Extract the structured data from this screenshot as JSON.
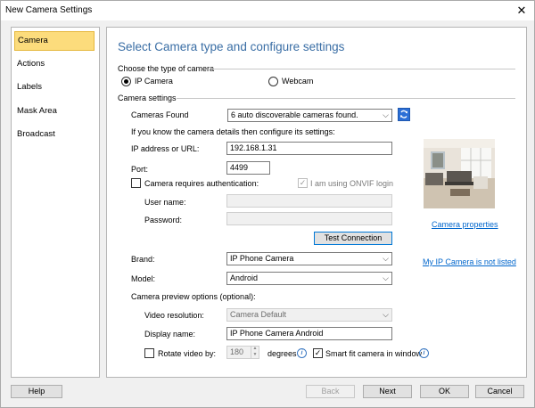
{
  "window": {
    "title": "New Camera Settings",
    "close_glyph": "✕"
  },
  "sidebar": {
    "items": [
      {
        "label": "Camera",
        "active": true
      },
      {
        "label": "Actions"
      },
      {
        "label": "Labels"
      },
      {
        "label": "Mask Area"
      },
      {
        "label": "Broadcast"
      }
    ]
  },
  "main": {
    "heading": "Select Camera type and configure settings",
    "camera_type": {
      "label": "Choose the type of camera",
      "options": [
        "IP Camera",
        "Webcam"
      ],
      "selected": "IP Camera"
    },
    "settings_label": "Camera settings",
    "cameras_found": {
      "label": "Cameras Found",
      "value": "6 auto discoverable cameras found."
    },
    "hint": "If you know the camera details then configure its settings:",
    "ip": {
      "label": "IP address or URL:",
      "value": "192.168.1.31"
    },
    "port": {
      "label": "Port:",
      "value": "4499"
    },
    "auth": {
      "label": "Camera requires authentication:",
      "checked": false,
      "onvif_label": "I am using ONVIF login",
      "onvif_checked": true
    },
    "username": {
      "label": "User name:",
      "value": ""
    },
    "password": {
      "label": "Password:",
      "value": ""
    },
    "test_button": "Test Connection",
    "brand": {
      "label": "Brand:",
      "value": "IP Phone Camera"
    },
    "model": {
      "label": "Model:",
      "value": "Android"
    },
    "preview_label": "Camera preview options (optional):",
    "video_resolution": {
      "label": "Video resolution:",
      "value": "Camera Default"
    },
    "display_name": {
      "label": "Display name:",
      "value": "IP Phone Camera Android"
    },
    "rotate": {
      "label": "Rotate video by:",
      "checked": false,
      "value": "180",
      "unit": "degrees"
    },
    "smart_fit": {
      "label": "Smart fit camera in window",
      "checked": true
    },
    "camera_properties_link": "Camera properties",
    "not_listed_link": "My IP Camera is not listed"
  },
  "footer": {
    "help": "Help",
    "back": "Back",
    "next": "Next",
    "ok": "OK",
    "cancel": "Cancel"
  },
  "icons": {
    "close": "close-icon",
    "refresh": "refresh-icon",
    "dropdown": "chevron-down-icon",
    "info": "info-icon",
    "check": "checkmark-icon"
  },
  "colors": {
    "accent": "#3a6ea5",
    "selected_nav": "#fcdc7c",
    "link": "#0066cc",
    "refresh_button": "#2c6fd6"
  }
}
